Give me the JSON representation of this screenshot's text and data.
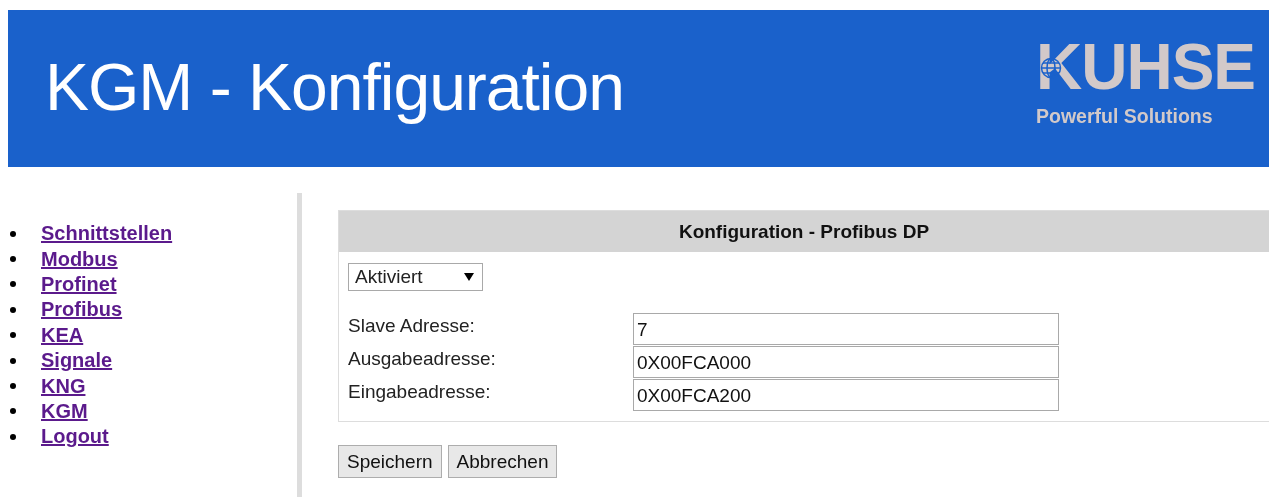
{
  "header": {
    "title": "KGM - Konfiguration",
    "logo": {
      "name": "KUHSE",
      "tagline": "Powerful Solutions"
    }
  },
  "nav": [
    {
      "label": "Schnittstellen"
    },
    {
      "label": "Modbus"
    },
    {
      "label": "Profinet"
    },
    {
      "label": "Profibus"
    },
    {
      "label": "KEA"
    },
    {
      "label": "Signale"
    },
    {
      "label": "KNG"
    },
    {
      "label": "KGM"
    },
    {
      "label": "Logout"
    }
  ],
  "panel": {
    "title": "Konfiguration - Profibus DP",
    "status_select": {
      "value": "Aktiviert"
    },
    "fields": [
      {
        "label": "Slave Adresse:",
        "value": "7"
      },
      {
        "label": "Ausgabeadresse:",
        "value": "0X00FCA000"
      },
      {
        "label": "Eingabeadresse:",
        "value": "0X00FCA200"
      }
    ],
    "buttons": [
      "Speichern",
      "Abbrechen"
    ]
  }
}
